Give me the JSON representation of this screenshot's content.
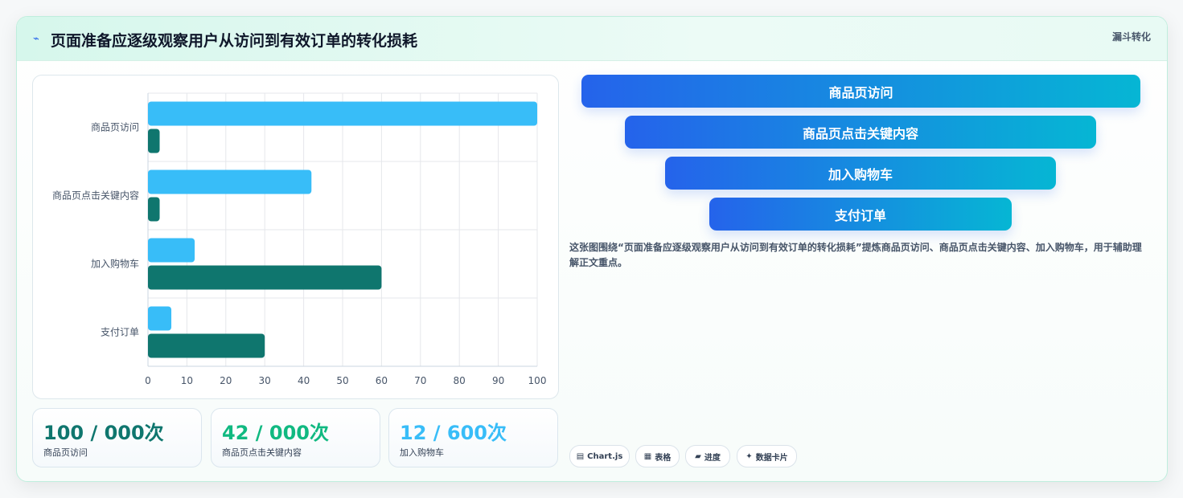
{
  "header": {
    "icon": "⌁",
    "title": "页面准备应逐级观察用户从访问到有效订单的转化损耗",
    "badge": "漏斗转化"
  },
  "chart_data": {
    "type": "bar",
    "orientation": "horizontal",
    "categories": [
      "商品页访问",
      "商品页点击关键内容",
      "加入购物车",
      "支付订单"
    ],
    "series": [
      {
        "values": [
          100,
          42,
          12,
          6
        ],
        "color": "#38bdf8"
      },
      {
        "values": [
          3,
          3,
          60,
          30
        ],
        "color": "#0f766e"
      }
    ],
    "xlim": [
      0,
      100
    ],
    "xticks": [
      0,
      10,
      20,
      30,
      40,
      50,
      60,
      70,
      80,
      90,
      100
    ],
    "grid": true
  },
  "stats": [
    {
      "value": "100 / 000次",
      "label": "商品页访问",
      "color": "#0f766e"
    },
    {
      "value": "42 / 000次",
      "label": "商品页点击关键内容",
      "color": "#10b981"
    },
    {
      "value": "12 / 600次",
      "label": "加入购物车",
      "color": "#38bdf8"
    }
  ],
  "funnel": [
    "商品页访问",
    "商品页点击关键内容",
    "加入购物车",
    "支付订单"
  ],
  "description": "这张图围绕“页面准备应逐级观察用户从访问到有效订单的转化损耗”提炼商品页访问、商品页点击关键内容、加入购物车，用于辅助理解正文重点。",
  "chips": [
    {
      "icon": "▤",
      "label": "Chart.js"
    },
    {
      "icon": "▦",
      "label": "表格"
    },
    {
      "icon": "▰",
      "label": "进度"
    },
    {
      "icon": "✦",
      "label": "数据卡片"
    }
  ]
}
